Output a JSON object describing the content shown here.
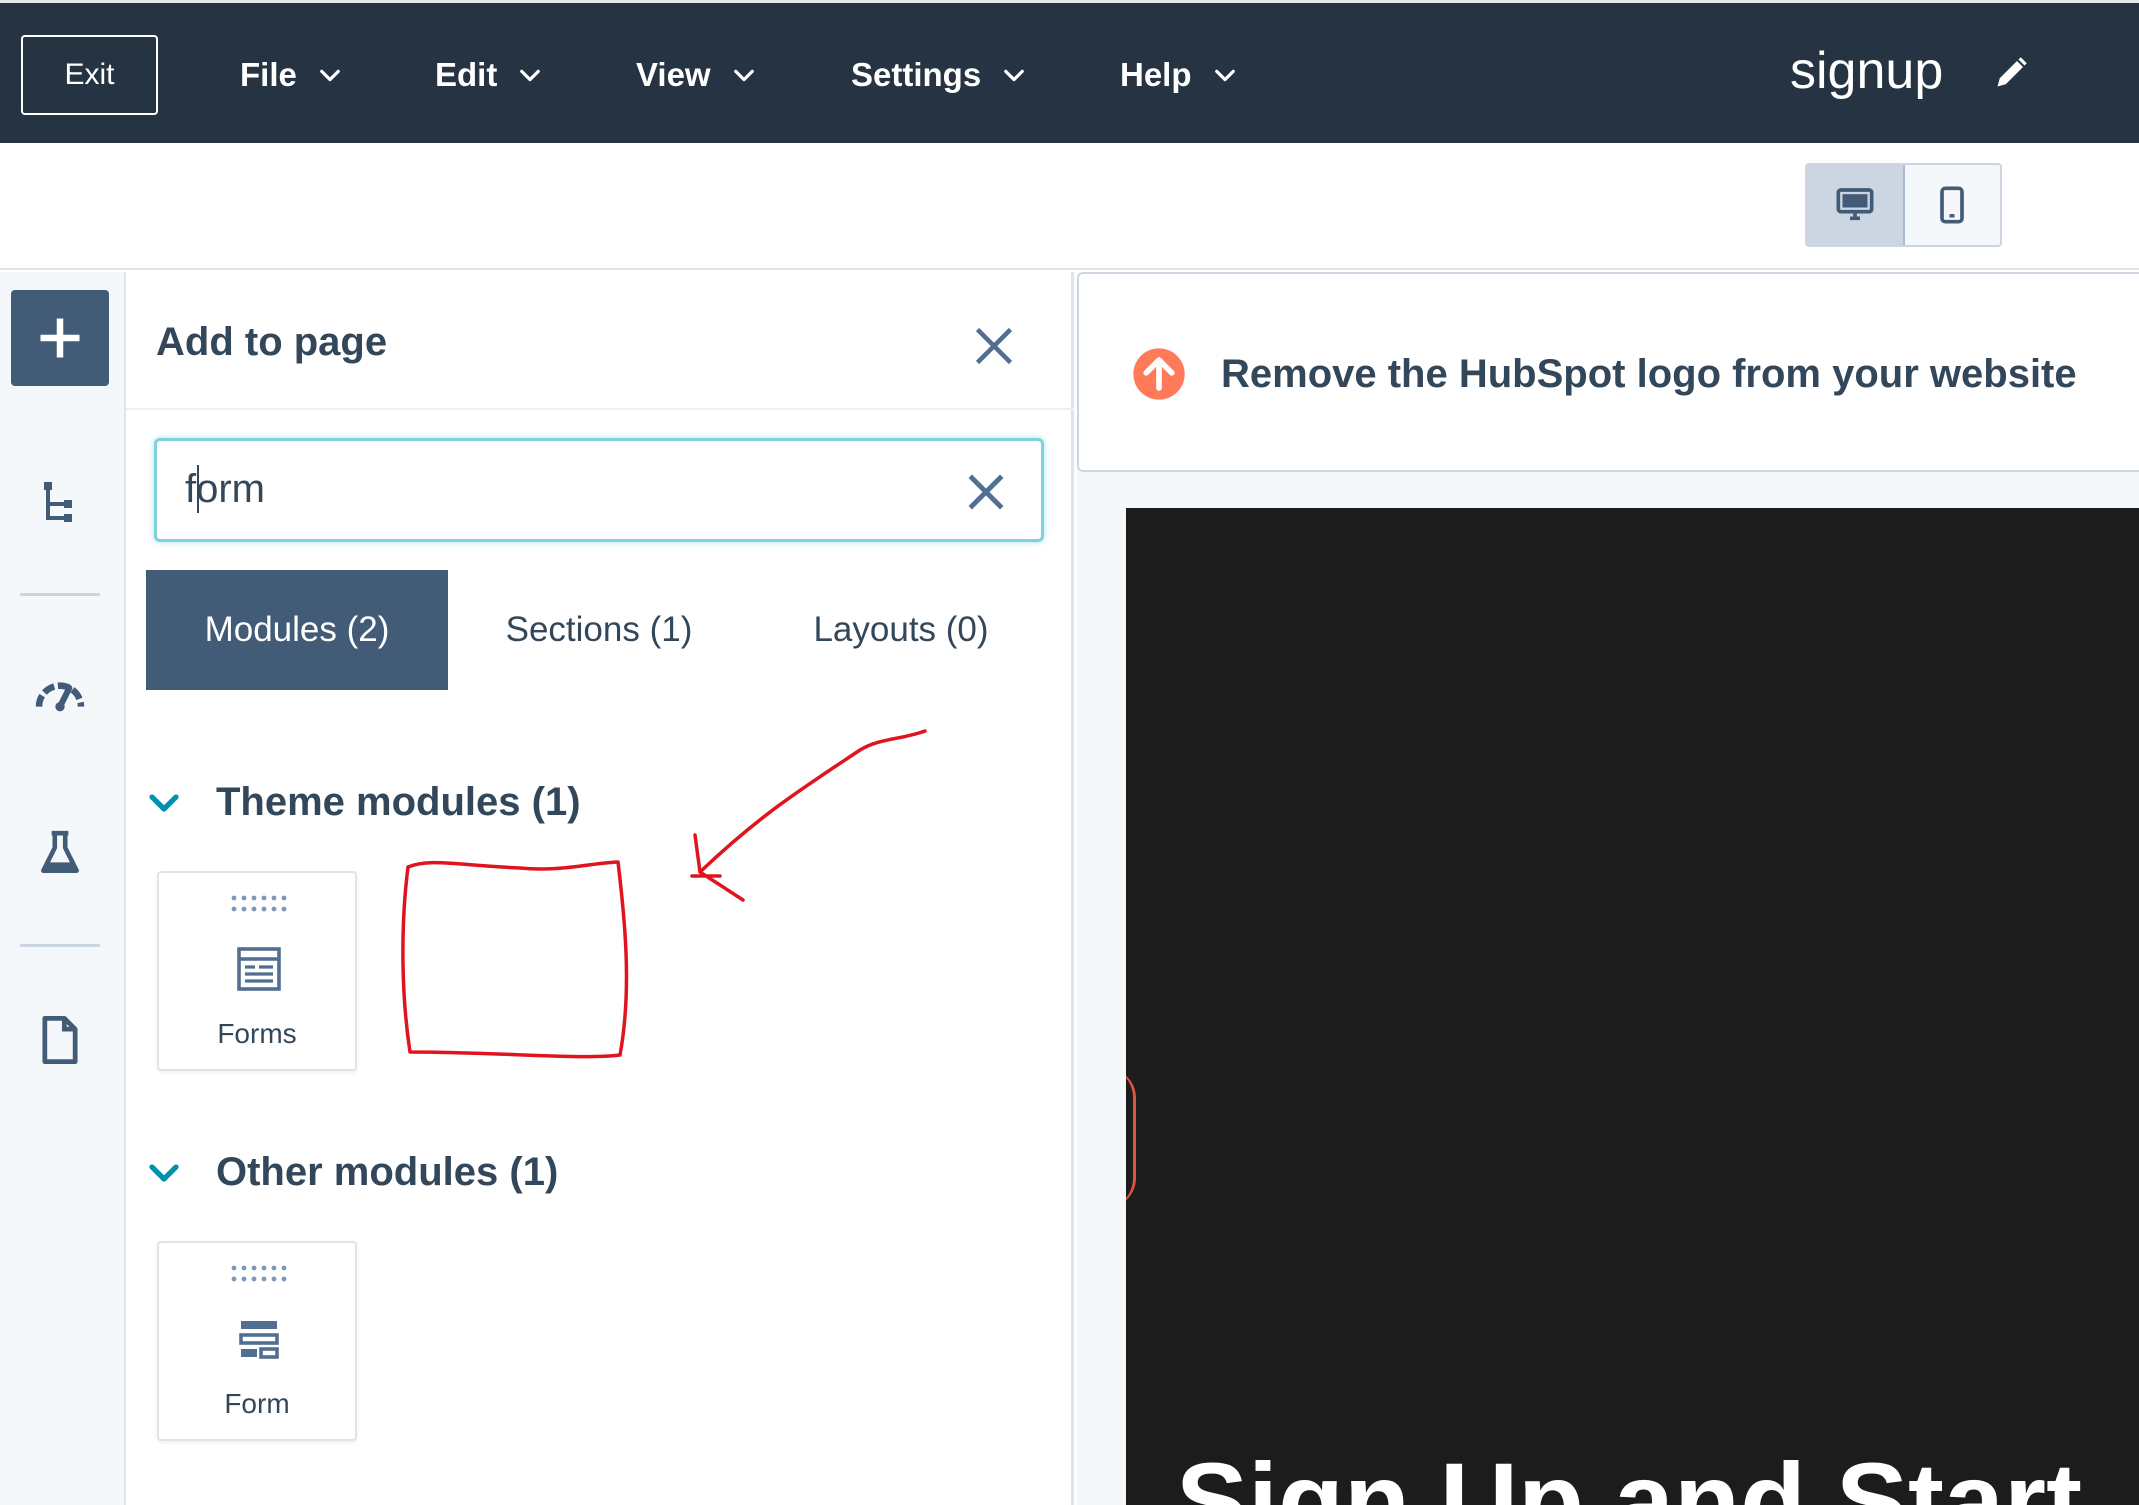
{
  "topbar": {
    "exit_label": "Exit",
    "menus": [
      "File",
      "Edit",
      "View",
      "Settings",
      "Help"
    ],
    "page_name": "signup"
  },
  "device_toggle": {
    "active": "desktop"
  },
  "rail": {
    "icons": [
      "plus-icon",
      "tree-icon",
      "gauge-icon",
      "flask-icon",
      "document-icon"
    ]
  },
  "panel": {
    "title": "Add to page",
    "search": {
      "value": "form"
    },
    "tabs": [
      {
        "label": "Modules (2)",
        "active": true
      },
      {
        "label": "Sections (1)",
        "active": false
      },
      {
        "label": "Layouts (0)",
        "active": false
      }
    ],
    "groups": [
      {
        "title": "Theme modules (1)",
        "modules": [
          {
            "label": "Forms",
            "icon": "form-layout-icon"
          }
        ]
      },
      {
        "title": "Other modules (1)",
        "modules": [
          {
            "label": "Form",
            "icon": "form-fields-icon"
          }
        ]
      }
    ]
  },
  "preview": {
    "banner_text": "Remove the HubSpot logo from your website",
    "hero_title": "Sign Up and Start"
  },
  "colors": {
    "topbar": "#253342",
    "accent": "#425b76",
    "banner_icon": "#ff7a59",
    "annotation": "#e0141e",
    "hero_bg": "#1c1c1c"
  }
}
